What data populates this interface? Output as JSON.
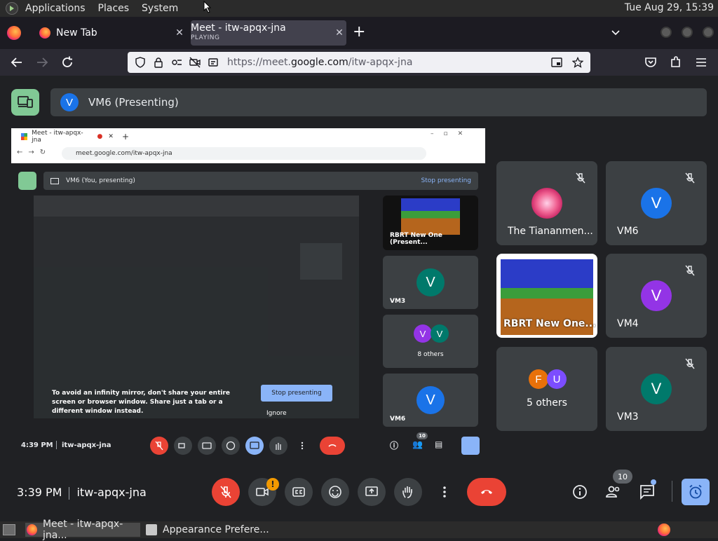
{
  "topbar": {
    "menus": [
      "Applications",
      "Places",
      "System"
    ],
    "clock": "Tue Aug 29, 15:39"
  },
  "browser": {
    "tabs": [
      {
        "title": "New Tab",
        "subtitle": ""
      },
      {
        "title": "Meet - itw-apqx-jna",
        "subtitle": "PLAYING"
      }
    ],
    "url_prefix": "https://meet.",
    "url_domain": "google.com",
    "url_path": "/itw-apqx-jna"
  },
  "meet": {
    "presenter_initial": "V",
    "presenter_label": "VM6 (Presenting)",
    "shared": {
      "tab_title": "Meet - itw-apqx-jna",
      "url": "meet.google.com/itw-apqx-jna",
      "present_label": "VM6 (You, presenting)",
      "stop_label": "Stop presenting",
      "warning": "To avoid an infinity mirror, don't share your entire screen or browser window. Share just a tab or a different window instead.",
      "stop_button": "Stop presenting",
      "ignore": "Ignore",
      "time": "4:39 PM",
      "meeting": "itw-apqx-jna",
      "count": "10",
      "tiles": [
        {
          "label": "RBRT New One (Present...",
          "initial": ""
        },
        {
          "label": "VM3",
          "initial": "V"
        },
        {
          "label": "8 others",
          "initial": "V"
        },
        {
          "label": "VM6",
          "initial": "V"
        }
      ]
    },
    "grid": [
      {
        "name": "The Tiananmen...",
        "initial": ""
      },
      {
        "name": "VM6",
        "initial": "V"
      },
      {
        "name": "RBRT New One...",
        "initial": ""
      },
      {
        "name": "VM4",
        "initial": "V"
      },
      {
        "name": "5 others",
        "initials": [
          "F",
          "U"
        ]
      },
      {
        "name": "VM3",
        "initial": "V"
      }
    ],
    "controls": {
      "time": "3:39 PM",
      "meeting_code": "itw-apqx-jna",
      "camera_alert": "!",
      "people_count": "10"
    },
    "colors": {
      "red": "#ea4335",
      "blue_avatar": "#1a73e8",
      "teal_avatar": "#00796b",
      "purple_avatar": "#9334e6",
      "orange_avatar": "#e8710a",
      "violet_avatar": "#7c4dff",
      "present_green": "#81c995",
      "active_blue": "#8ab4f8"
    }
  },
  "taskbar": {
    "items": [
      "Meet - itw-apqx-jna...",
      "Appearance Prefere..."
    ]
  }
}
